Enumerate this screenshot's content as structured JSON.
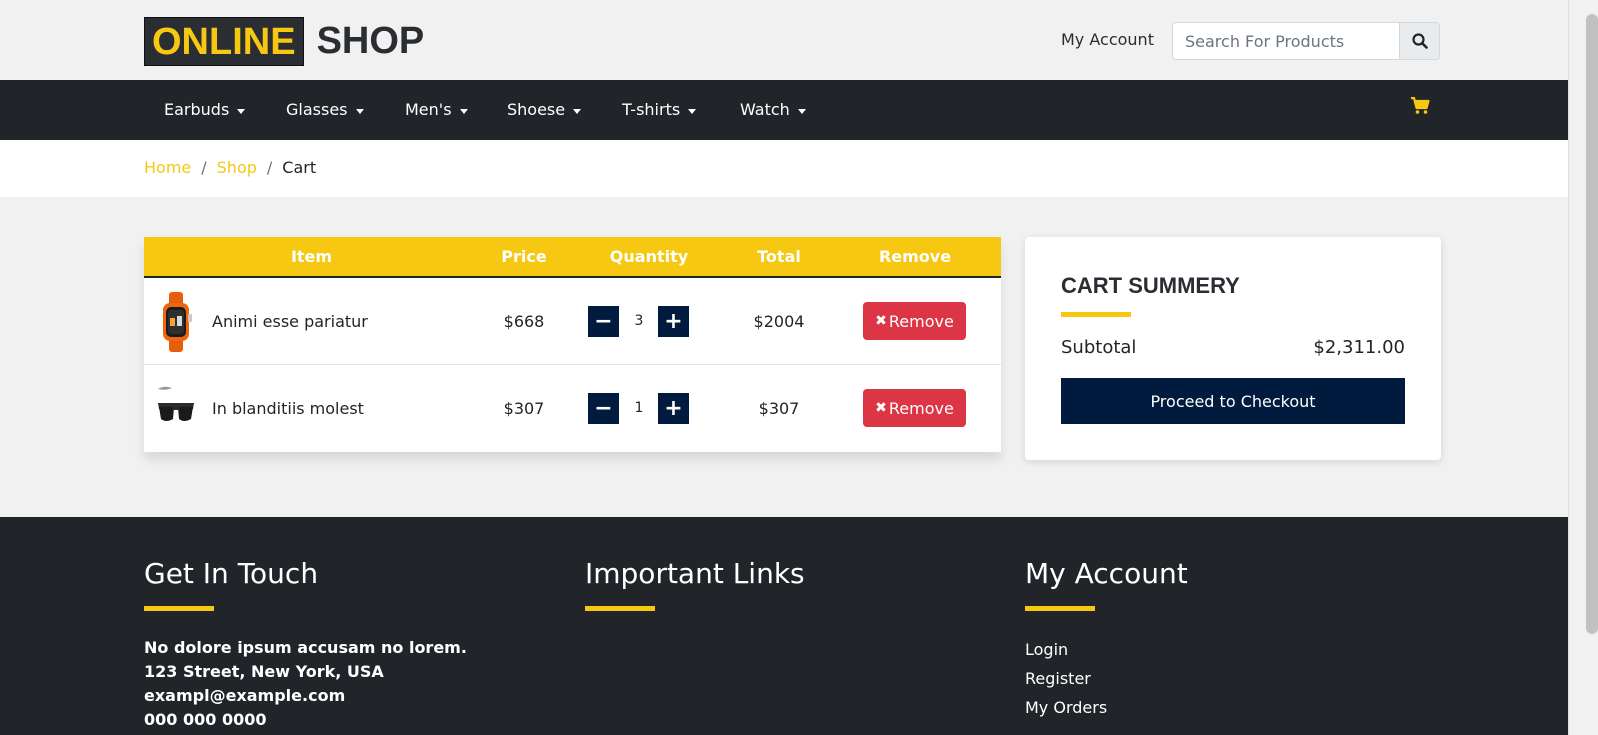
{
  "header": {
    "logo_highlight": "ONLINE",
    "logo_text": "SHOP",
    "my_account": "My Account",
    "search_placeholder": "Search For Products"
  },
  "nav": {
    "items": [
      {
        "label": "Earbuds"
      },
      {
        "label": "Glasses"
      },
      {
        "label": "Men's"
      },
      {
        "label": "Shoese"
      },
      {
        "label": "T-shirts"
      },
      {
        "label": "Watch"
      }
    ],
    "cart_icon": "shopping-cart-icon"
  },
  "breadcrumb": {
    "home": "Home",
    "shop": "Shop",
    "current": "Cart",
    "separator": "/"
  },
  "cart": {
    "headers": {
      "item": "Item",
      "price": "Price",
      "quantity": "Quantity",
      "total": "Total",
      "remove": "Remove"
    },
    "rows": [
      {
        "name": "Animi esse pariatur",
        "price": "$668",
        "quantity": "3",
        "total": "$2004",
        "remove_label": "Remove",
        "image": "orange-smartwatch"
      },
      {
        "name": "In blanditiis molest",
        "price": "$307",
        "quantity": "1",
        "total": "$307",
        "remove_label": "Remove",
        "image": "black-sunglasses"
      }
    ],
    "minus_symbol": "−",
    "plus_symbol": "+",
    "remove_icon": "✖"
  },
  "summary": {
    "title": "CART SUMMERY",
    "subtotal_label": "Subtotal",
    "subtotal_value": "$2,311.00",
    "checkout_label": "Proceed to Checkout"
  },
  "footer": {
    "contact": {
      "title": "Get In Touch",
      "lines": [
        "No dolore ipsum accusam no lorem.",
        "123 Street, New York, USA",
        "exampl@example.com",
        "000 000 0000"
      ]
    },
    "links": {
      "title": "Important Links"
    },
    "account": {
      "title": "My Account",
      "links": [
        "Login",
        "Register",
        "My Orders"
      ]
    }
  },
  "colors": {
    "accent": "#f7c811",
    "dark": "#212529",
    "navy": "#001b3d",
    "danger": "#dc3545"
  }
}
